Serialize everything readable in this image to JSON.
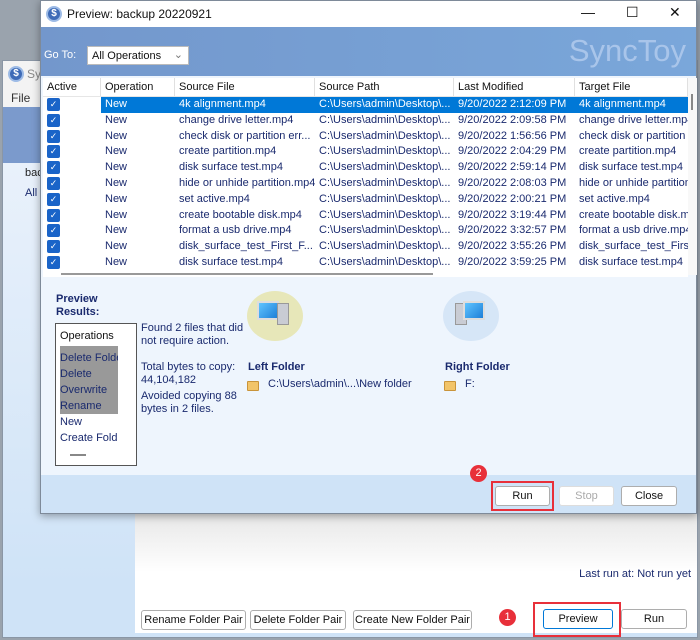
{
  "background_window": {
    "title": "Sy",
    "menu": [
      "File"
    ],
    "folder_pairs": [
      "bac",
      "All F"
    ],
    "last_run": "Last run at: Not run yet",
    "buttons": {
      "rename": "Rename Folder Pair",
      "delete": "Delete Folder Pair",
      "create": "Create New Folder Pair",
      "preview": "Preview",
      "run": "Run"
    },
    "step_badge": "1"
  },
  "dialog": {
    "title": "Preview: backup 20220921",
    "controls": {
      "minimize": "—",
      "maximize": "☐",
      "close": "✕"
    },
    "goto_label": "Go To:",
    "goto_value": "All Operations",
    "brand": "SyncToy",
    "columns": [
      "Active",
      "Operation",
      "Source File",
      "Source Path",
      "Last Modified",
      "Target File"
    ],
    "rows": [
      {
        "op": "New",
        "src": "4k alignment.mp4",
        "path": "C:\\Users\\admin\\Desktop\\...",
        "mod": "9/20/2022 2:12:09 PM",
        "target": "4k alignment.mp4",
        "selected": true
      },
      {
        "op": "New",
        "src": "change drive letter.mp4",
        "path": "C:\\Users\\admin\\Desktop\\...",
        "mod": "9/20/2022 2:09:58 PM",
        "target": "change drive letter.mp4"
      },
      {
        "op": "New",
        "src": "check disk or partition err...",
        "path": "C:\\Users\\admin\\Desktop\\...",
        "mod": "9/20/2022 1:56:56 PM",
        "target": "check disk or partition e"
      },
      {
        "op": "New",
        "src": "create partition.mp4",
        "path": "C:\\Users\\admin\\Desktop\\...",
        "mod": "9/20/2022 2:04:29 PM",
        "target": "create partition.mp4"
      },
      {
        "op": "New",
        "src": "disk surface test.mp4",
        "path": "C:\\Users\\admin\\Desktop\\...",
        "mod": "9/20/2022 2:59:14 PM",
        "target": "disk surface test.mp4"
      },
      {
        "op": "New",
        "src": "hide or unhide partition.mp4",
        "path": "C:\\Users\\admin\\Desktop\\...",
        "mod": "9/20/2022 2:08:03 PM",
        "target": "hide or unhide partition"
      },
      {
        "op": "New",
        "src": "set active.mp4",
        "path": "C:\\Users\\admin\\Desktop\\...",
        "mod": "9/20/2022 2:00:21 PM",
        "target": "set active.mp4"
      },
      {
        "op": "New",
        "src": "create bootable disk.mp4",
        "path": "C:\\Users\\admin\\Desktop\\...",
        "mod": "9/20/2022 3:19:44 PM",
        "target": "create bootable disk.m"
      },
      {
        "op": "New",
        "src": "format a usb drive.mp4",
        "path": "C:\\Users\\admin\\Desktop\\...",
        "mod": "9/20/2022 3:32:57 PM",
        "target": "format a usb drive.mp4"
      },
      {
        "op": "New",
        "src": "disk_surface_test_First_F...",
        "path": "C:\\Users\\admin\\Desktop\\...",
        "mod": "9/20/2022 3:55:26 PM",
        "target": "disk_surface_test_First"
      },
      {
        "op": "New",
        "src": "disk surface test.mp4",
        "path": "C:\\Users\\admin\\Desktop\\...",
        "mod": "9/20/2022 3:59:25 PM",
        "target": "disk surface test.mp4"
      }
    ],
    "preview_results_label": [
      "Preview",
      "Results:"
    ],
    "operations": [
      "Operations",
      "Delete Folde",
      "Delete",
      "Overwrite",
      "Rename",
      "New",
      "Create Folde"
    ],
    "info": {
      "found": [
        "Found 2 files that did",
        "not require action."
      ],
      "total": [
        "Total bytes to copy:",
        "44,104,182"
      ],
      "avoided": [
        "Avoided copying 88",
        "bytes in 2 files."
      ]
    },
    "left_folder": {
      "label": "Left Folder",
      "path": "C:\\Users\\admin\\...\\New folder"
    },
    "right_folder": {
      "label": "Right Folder",
      "path": "F:"
    },
    "buttons": {
      "run": "Run",
      "stop": "Stop",
      "close": "Close"
    },
    "step_badge": "2"
  },
  "colors": {
    "highlight": "#e8303a",
    "selection": "#0078d7",
    "header": "#7397cc"
  }
}
